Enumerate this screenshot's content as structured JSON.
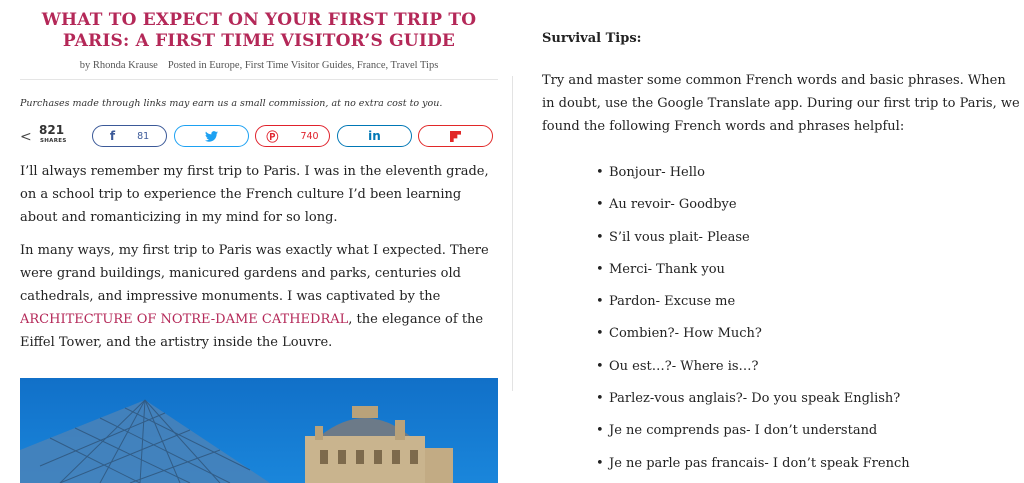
{
  "article": {
    "title": "WHAT TO EXPECT ON YOUR FIRST TRIP TO PARIS: A FIRST TIME VISITOR’S GUIDE",
    "byline": {
      "author": "by Rhonda Krause",
      "posted": "Posted in Europe, First Time Visitor Guides, France, Travel Tips"
    },
    "disclaimer": "Purchases made through links may earn us a small commission, at no extra cost to you.",
    "shares": {
      "total": "821",
      "total_label": "SHARES",
      "facebook_count": "81",
      "pinterest_count": "740",
      "icons": {
        "share": "share-icon",
        "facebook": "facebook-icon",
        "twitter": "twitter-icon",
        "pinterest": "pinterest-icon",
        "linkedin": "linkedin-icon",
        "flipboard": "flipboard-icon"
      }
    },
    "paragraph1": "I’ll always remember my first trip to Paris. I was in the eleventh grade, on a school trip to experience the French culture I’d been learning about and romanticizing in my mind for so long.",
    "paragraph2": {
      "before": "In many ways, my first trip to Paris was exactly what I expected. There were grand buildings, manicured gardens and parks, centuries old cathedrals, and impressive monuments. I was captivated by the ",
      "link": "ARCHITECTURE OF NOTRE-DAME CATHEDRAL",
      "after": ", the elegance of the Eiffel Tower, and the artistry inside the Louvre."
    }
  },
  "sidebar": {
    "heading": "Survival Tips:",
    "intro": "Try and master some common French words and basic phrases. When in doubt, use the Google Translate app. During our first trip to Paris, we found the following French words and phrases helpful:",
    "tips": [
      "Bonjour- Hello",
      "Au revoir- Goodbye",
      "S’il vous plait- Please",
      "Merci- Thank you",
      "Pardon- Excuse me",
      "Combien?- How Much?",
      "Ou est…?- Where is…?",
      "Parlez-vous anglais?- Do you speak English?",
      "Je ne comprends pas- I don’t understand",
      "Je ne parle pas francais- I don’t speak French"
    ]
  },
  "colors": {
    "accent": "#b42858",
    "facebook": "#3b5998",
    "twitter": "#1da1f2",
    "pinterest": "#e0222c",
    "linkedin": "#0077b5",
    "flipboard": "#e12828"
  }
}
